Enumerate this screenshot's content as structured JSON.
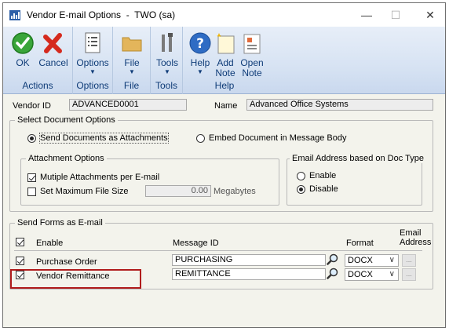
{
  "window": {
    "title": "Vendor E-mail Options  -  TWO (sa)",
    "controls": {
      "minimize": "—",
      "maximize": "☐",
      "close": "✕"
    }
  },
  "ribbon": {
    "groups": [
      {
        "caption": "Actions",
        "buttons": [
          {
            "label": "OK",
            "icon": "ok-check-icon"
          },
          {
            "label": "Cancel",
            "icon": "cancel-x-icon"
          }
        ]
      },
      {
        "caption": "Options",
        "buttons": [
          {
            "label": "Options",
            "icon": "options-document-icon"
          }
        ]
      },
      {
        "caption": "File",
        "buttons": [
          {
            "label": "File",
            "icon": "folder-icon"
          }
        ]
      },
      {
        "caption": "Tools",
        "buttons": [
          {
            "label": "Tools",
            "icon": "tools-icon"
          }
        ]
      },
      {
        "caption": "Help",
        "buttons": [
          {
            "label": "Help",
            "icon": "help-icon"
          },
          {
            "label1": "Add",
            "label2": "Note",
            "icon": "add-note-icon"
          },
          {
            "label1": "Open",
            "label2": "Note",
            "icon": "open-note-icon"
          }
        ]
      }
    ]
  },
  "vendor": {
    "id_label": "Vendor ID",
    "id_value": "ADVANCED0001",
    "name_label": "Name",
    "name_value": "Advanced Office Systems"
  },
  "select_document": {
    "title": "Select Document Options",
    "option_attachments": "Send Documents as Attachments",
    "option_embed": "Embed Document in Message Body",
    "selected": "attachments"
  },
  "attachment_options": {
    "title": "Attachment Options",
    "multiple_label": "Mutiple Attachments per E-mail",
    "multiple_checked": true,
    "max_size_label": "Set Maximum File Size",
    "max_size_checked": false,
    "max_size_value": "0.00",
    "max_size_unit": "Megabytes"
  },
  "doc_type": {
    "title": "Email Address based on Doc Type",
    "enable_label": "Enable",
    "disable_label": "Disable",
    "selected": "disable"
  },
  "send_forms": {
    "title": "Send Forms as E-mail",
    "headers": {
      "enable": "Enable",
      "message_id": "Message ID",
      "format": "Format",
      "email_line1": "Email",
      "email_line2": "Address"
    },
    "header_checked": true,
    "rows": [
      {
        "enabled": true,
        "name": "Purchase Order",
        "message_id": "PURCHASING",
        "format": "DOCX",
        "email_button": "..."
      },
      {
        "enabled": true,
        "name": "Vendor Remittance",
        "message_id": "REMITTANCE",
        "format": "DOCX",
        "email_button": "..."
      }
    ]
  },
  "colors": {
    "highlight": "#b01c1c",
    "ribbon_text": "#0f3c78",
    "background": "#f3f3ec"
  }
}
